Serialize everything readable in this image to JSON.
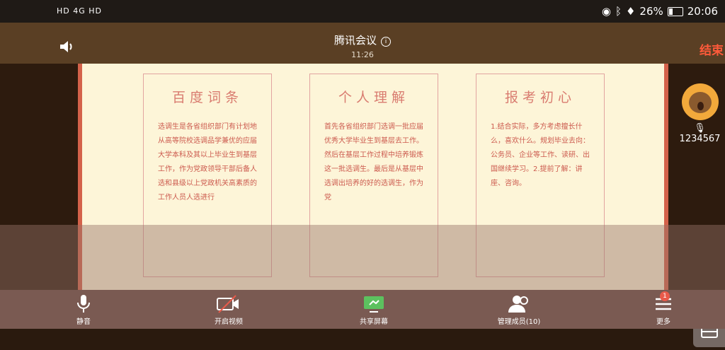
{
  "status_bar": {
    "left_icons": "HD 4G HD",
    "battery": "26%",
    "time": "20:06"
  },
  "meeting": {
    "title": "腾讯会议",
    "time": "11:26",
    "end_label": "结束"
  },
  "slide": {
    "cards": [
      {
        "title": "百度词条",
        "body": "选调生是各省组织部门有计划地从高等院校选调品学兼优的应届大学本科及其以上毕业生到基层工作，作为党政领导干部后备人选和县级以上党政机关高素质的工作人员人选进行"
      },
      {
        "title": "个人理解",
        "body": "首先各省组织部门选调一批应届优秀大学毕业生到基层去工作。然后在基层工作过程中培养锻炼这一批选调生。最后是从基层中选调出培养的好的选调生，作为党"
      },
      {
        "title": "报考初心",
        "body": "1.结合实际，多方考虑擅长什么，喜欢什么。规划毕业去向：公务员、企业等工作、读研、出国继续学习。2.提前了解：讲座、咨询。"
      }
    ]
  },
  "participant": {
    "name": "1234567"
  },
  "toolbar": {
    "mute": "静音",
    "video": "开启视频",
    "share": "共享屏幕",
    "members": "管理成员(10)",
    "more": "更多",
    "more_badge": "1"
  }
}
